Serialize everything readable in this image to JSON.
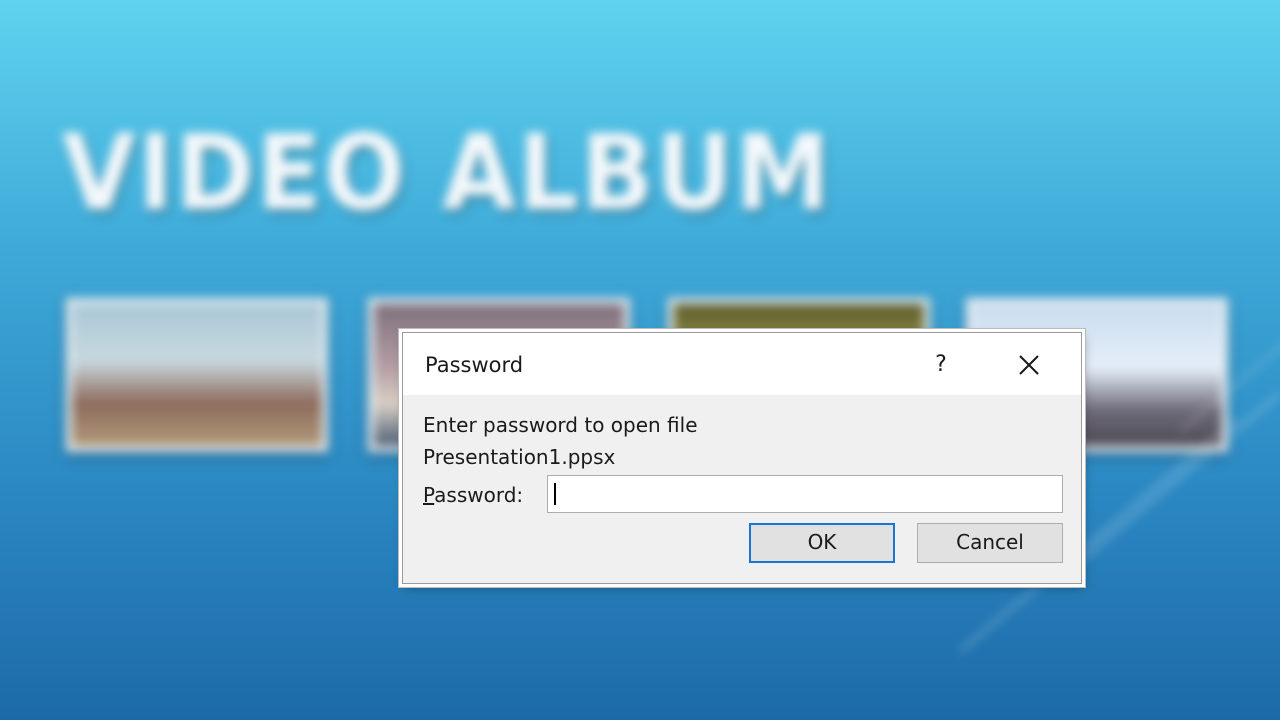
{
  "background": {
    "slide_title": "VIDEO ALBUM"
  },
  "dialog": {
    "title": "Password",
    "help_label": "?",
    "close_icon": "close-icon",
    "prompt": "Enter password to open file",
    "filename": "Presentation1.ppsx",
    "password_label_underlined": "P",
    "password_label_rest": "assword:",
    "password_value": "",
    "ok_label": "OK",
    "cancel_label": "Cancel",
    "accent_color": "#1a74d2"
  }
}
